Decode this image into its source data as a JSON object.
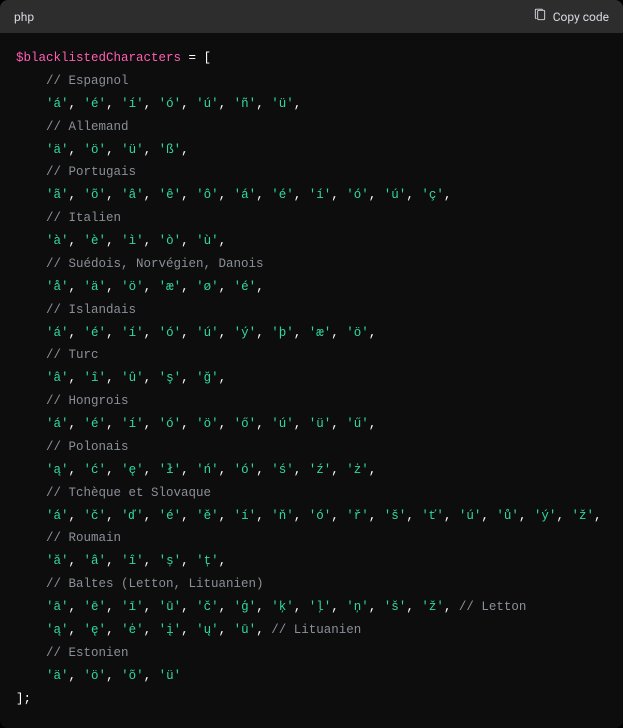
{
  "header": {
    "language": "php",
    "copy_label": "Copy code"
  },
  "code": {
    "var_name": "$blacklistedCharacters",
    "assign": " = [",
    "close": "];",
    "groups": [
      {
        "comment": "// Espagnol",
        "chars": [
          "'á'",
          "'é'",
          "'í'",
          "'ó'",
          "'ú'",
          "'ñ'",
          "'ü'"
        ],
        "trailing_comma": true
      },
      {
        "comment": "// Allemand",
        "chars": [
          "'ä'",
          "'ö'",
          "'ü'",
          "'ß'"
        ],
        "trailing_comma": true
      },
      {
        "comment": "// Portugais",
        "chars": [
          "'ã'",
          "'õ'",
          "'â'",
          "'ê'",
          "'ô'",
          "'á'",
          "'é'",
          "'í'",
          "'ó'",
          "'ú'",
          "'ç'"
        ],
        "trailing_comma": true
      },
      {
        "comment": "// Italien",
        "chars": [
          "'à'",
          "'è'",
          "'ì'",
          "'ò'",
          "'ù'"
        ],
        "trailing_comma": true
      },
      {
        "comment": "// Suédois, Norvégien, Danois",
        "chars": [
          "'å'",
          "'ä'",
          "'ö'",
          "'æ'",
          "'ø'",
          "'é'"
        ],
        "trailing_comma": true
      },
      {
        "comment": "// Islandais",
        "chars": [
          "'á'",
          "'é'",
          "'í'",
          "'ó'",
          "'ú'",
          "'ý'",
          "'þ'",
          "'æ'",
          "'ö'"
        ],
        "trailing_comma": true
      },
      {
        "comment": "// Turc",
        "chars": [
          "'â'",
          "'î'",
          "'û'",
          "'ş'",
          "'ğ'"
        ],
        "trailing_comma": true
      },
      {
        "comment": "// Hongrois",
        "chars": [
          "'á'",
          "'é'",
          "'í'",
          "'ó'",
          "'ö'",
          "'ő'",
          "'ú'",
          "'ü'",
          "'ű'"
        ],
        "trailing_comma": true
      },
      {
        "comment": "// Polonais",
        "chars": [
          "'ą'",
          "'ć'",
          "'ę'",
          "'ł'",
          "'ń'",
          "'ó'",
          "'ś'",
          "'ź'",
          "'ż'"
        ],
        "trailing_comma": true
      },
      {
        "comment": "// Tchèque et Slovaque",
        "chars": [
          "'á'",
          "'č'",
          "'ď'",
          "'é'",
          "'ě'",
          "'í'",
          "'ň'",
          "'ó'",
          "'ř'",
          "'š'",
          "'ť'",
          "'ú'",
          "'ů'",
          "'ý'",
          "'ž'"
        ],
        "trailing_comma": true
      },
      {
        "comment": "// Roumain",
        "chars": [
          "'ă'",
          "'â'",
          "'î'",
          "'ș'",
          "'ț'"
        ],
        "trailing_comma": true
      },
      {
        "comment": "// Baltes (Letton, Lituanien)",
        "lines": [
          {
            "chars": [
              "'ā'",
              "'ē'",
              "'ī'",
              "'ū'",
              "'č'",
              "'ģ'",
              "'ķ'",
              "'ļ'",
              "'ņ'",
              "'š'",
              "'ž'"
            ],
            "trailing_comma": true,
            "inline_comment": "// Letton"
          },
          {
            "chars": [
              "'ą'",
              "'ę'",
              "'ė'",
              "'į'",
              "'ų'",
              "'ū'"
            ],
            "trailing_comma": true,
            "inline_comment": "// Lituanien"
          }
        ]
      },
      {
        "comment": "// Estonien",
        "chars": [
          "'ä'",
          "'ö'",
          "'õ'",
          "'ü'"
        ],
        "trailing_comma": false
      }
    ]
  }
}
